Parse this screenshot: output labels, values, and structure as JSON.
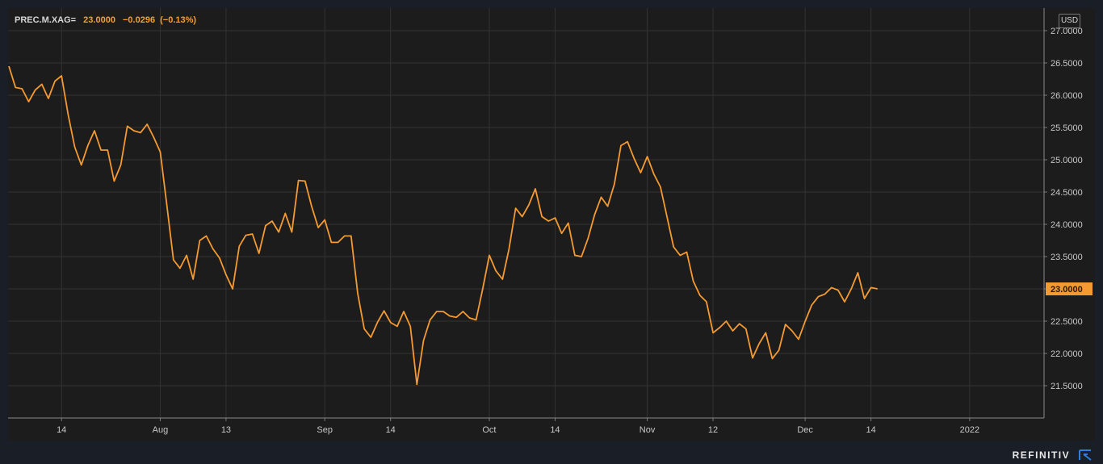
{
  "header": {
    "symbol": "PREC.M.XAG=",
    "last": "23.0000",
    "change": "−0.0296",
    "change_pct": "(−0.13%)"
  },
  "currency": "USD",
  "brand": "REFINITIV",
  "colors": {
    "line": "#f59a30",
    "last_label_bg": "#f59a30",
    "grid": "#333333",
    "text": "#c8c8c8"
  },
  "chart_data": {
    "type": "line",
    "title": "",
    "xlabel": "",
    "ylabel": "",
    "ylim": [
      21.0,
      27.25
    ],
    "yticks": [
      "27.0000",
      "26.5000",
      "26.0000",
      "25.5000",
      "25.0000",
      "24.5000",
      "24.0000",
      "23.5000",
      "23.0000",
      "22.5000",
      "22.0000",
      "21.5000"
    ],
    "xticks": [
      {
        "label": "14",
        "index": 8
      },
      {
        "label": "Aug",
        "index": 23
      },
      {
        "label": "13",
        "index": 33
      },
      {
        "label": "Sep",
        "index": 48
      },
      {
        "label": "14",
        "index": 58
      },
      {
        "label": "Oct",
        "index": 73
      },
      {
        "label": "14",
        "index": 83
      },
      {
        "label": "Nov",
        "index": 97
      },
      {
        "label": "12",
        "index": 107
      },
      {
        "label": "Dec",
        "index": 121
      },
      {
        "label": "14",
        "index": 131
      },
      {
        "label": "2022",
        "index": 146
      }
    ],
    "last_value": "23.0000",
    "series": [
      {
        "values": [
          26.45,
          26.12,
          26.1,
          25.9,
          26.08,
          26.17,
          25.95,
          26.22,
          26.3,
          25.7,
          25.2,
          24.92,
          25.22,
          25.45,
          25.15,
          25.15,
          24.67,
          24.92,
          25.52,
          25.45,
          25.42,
          25.55,
          25.35,
          25.12,
          24.3,
          23.45,
          23.32,
          23.52,
          23.15,
          23.75,
          23.82,
          23.62,
          23.48,
          23.22,
          23.0,
          23.66,
          23.83,
          23.85,
          23.55,
          23.98,
          24.05,
          23.88,
          24.17,
          23.88,
          24.68,
          24.67,
          24.28,
          23.95,
          24.07,
          23.72,
          23.72,
          23.82,
          23.82,
          22.93,
          22.38,
          22.25,
          22.48,
          22.66,
          22.48,
          22.42,
          22.65,
          22.42,
          21.52,
          22.2,
          22.52,
          22.65,
          22.65,
          22.58,
          22.56,
          22.65,
          22.55,
          22.52,
          23.0,
          23.52,
          23.28,
          23.15,
          23.62,
          24.25,
          24.12,
          24.3,
          24.55,
          24.12,
          24.05,
          24.1,
          23.86,
          24.02,
          23.52,
          23.5,
          23.78,
          24.15,
          24.42,
          24.28,
          24.62,
          25.22,
          25.28,
          25.02,
          24.8,
          25.05,
          24.78,
          24.58,
          24.12,
          23.65,
          23.52,
          23.57,
          23.12,
          22.9,
          22.8,
          22.32,
          22.4,
          22.5,
          22.35,
          22.46,
          22.38,
          21.93,
          22.15,
          22.32,
          21.92,
          22.05,
          22.45,
          22.35,
          22.22,
          22.5,
          22.75,
          22.88,
          22.92,
          23.02,
          22.98,
          22.8,
          23.0,
          23.25,
          22.85,
          23.02,
          23.0
        ]
      }
    ]
  }
}
